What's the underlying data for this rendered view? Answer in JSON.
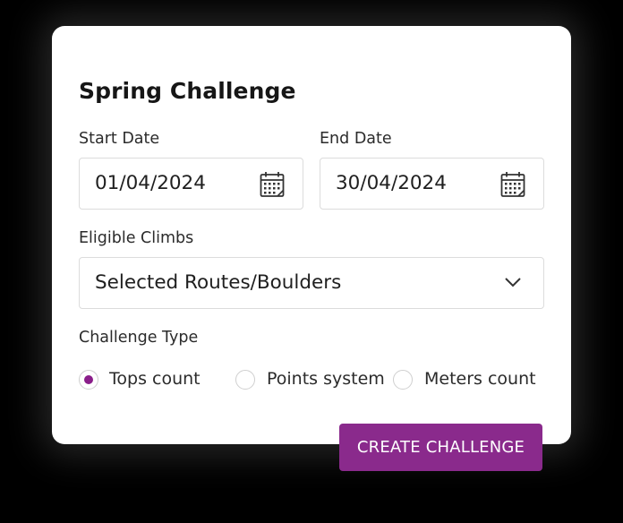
{
  "form": {
    "title": "Spring Challenge",
    "start_date": {
      "label": "Start Date",
      "value": "01/04/2024",
      "icon": "calendar-icon"
    },
    "end_date": {
      "label": "End Date",
      "value": "30/04/2024",
      "icon": "calendar-icon"
    },
    "eligible_climbs": {
      "label": "Eligible Climbs",
      "value": "Selected Routes/Boulders",
      "icon": "chevron-down-icon"
    },
    "challenge_type": {
      "label": "Challenge Type",
      "options": [
        {
          "label": "Tops count",
          "selected": true
        },
        {
          "label": "Points system",
          "selected": false
        },
        {
          "label": "Meters count",
          "selected": false
        }
      ]
    },
    "submit_label": "CREATE CHALLENGE"
  },
  "colors": {
    "accent": "#8a2a8c",
    "radio_selected": "#8a1e8a",
    "background": "#000000",
    "card": "#ffffff"
  }
}
